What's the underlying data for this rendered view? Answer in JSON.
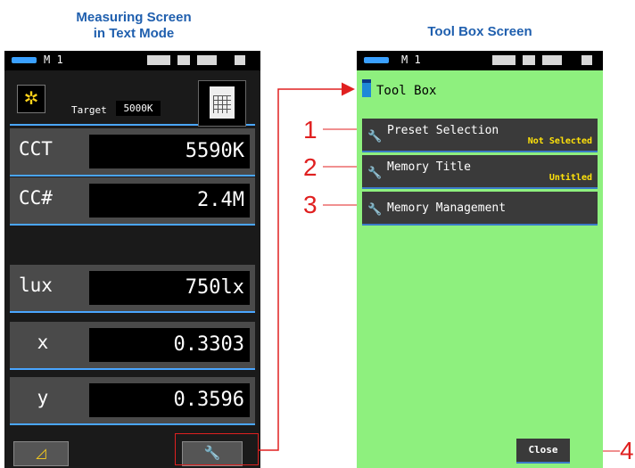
{
  "captions": {
    "left_line1": "Measuring Screen",
    "left_line2": "in Text Mode",
    "right": "Tool Box Screen"
  },
  "status": {
    "memory_label": "M 1"
  },
  "measure": {
    "target_label": "Target",
    "target_value": "5000K",
    "rows": [
      {
        "label": "CCT",
        "value": "5590K"
      },
      {
        "label": "CC#",
        "value": "2.4M"
      },
      {
        "label": "lux",
        "value": "750lx"
      },
      {
        "label": "x",
        "value": "0.3303"
      },
      {
        "label": "y",
        "value": "0.3596"
      }
    ],
    "left_button_glyph": "◿",
    "wrench_glyph": "🔧"
  },
  "toolbox": {
    "title": "Tool Box",
    "items": [
      {
        "title": "Preset Selection",
        "sub": "Not Selected"
      },
      {
        "title": "Memory Title",
        "sub": "Untitled"
      },
      {
        "title": "Memory Management",
        "sub": ""
      }
    ],
    "close_label": "Close"
  },
  "callouts": [
    "1",
    "2",
    "3",
    "4"
  ],
  "colors": {
    "accent_blue": "#4aa6ff",
    "toolbox_bg": "#8ef07e",
    "annotation_red": "#e02020",
    "caption_blue": "#1f5fae"
  },
  "icons": [
    "sun-icon",
    "document-grid-icon",
    "wrench-icon",
    "toolbox-icon",
    "battery-icon"
  ]
}
